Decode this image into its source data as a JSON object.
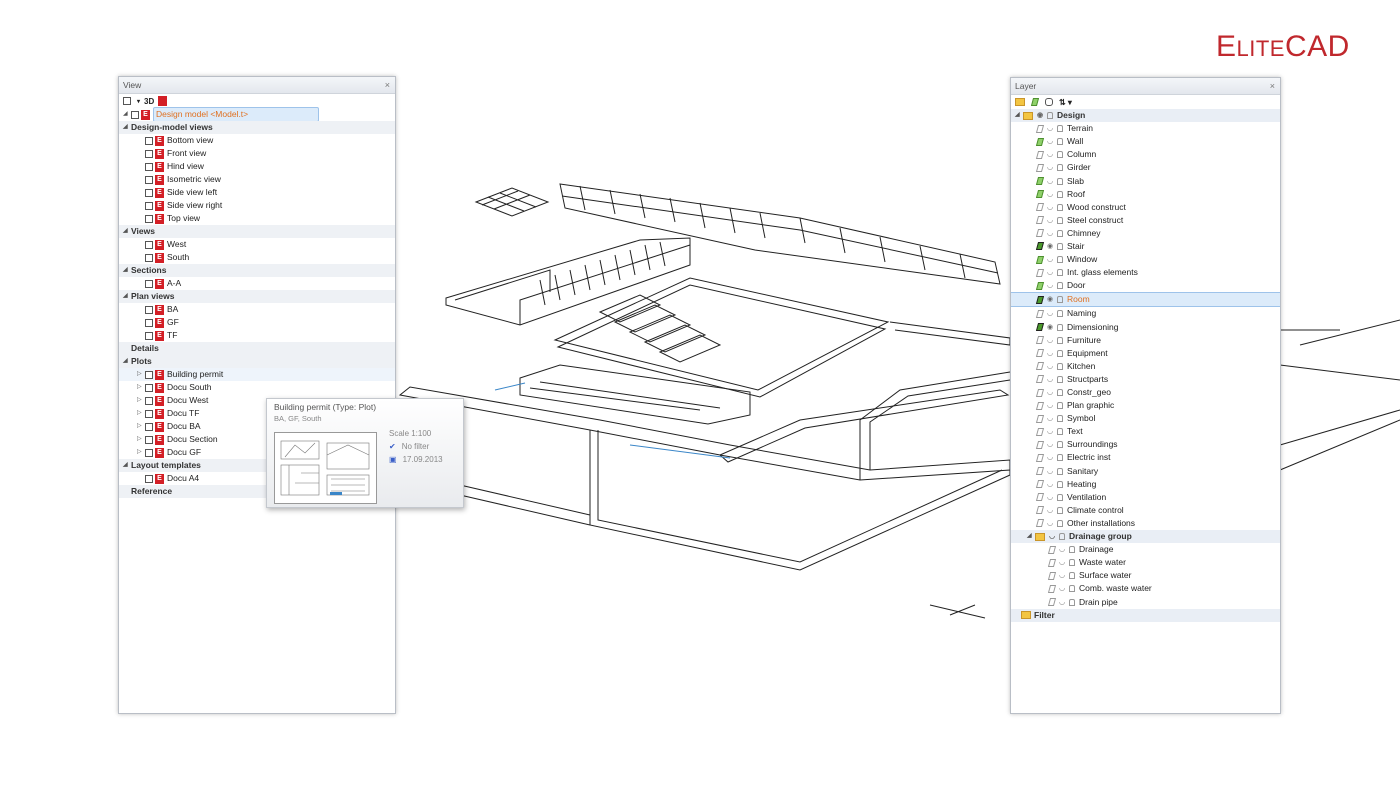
{
  "logo": {
    "e": "E",
    "lite": "LITE",
    "cad": "CAD"
  },
  "view_panel": {
    "title": "View",
    "close": "×",
    "toolbar_3d": "3D",
    "root_label": "Design model <Model.t>",
    "sections": [
      {
        "label": "Design-model views",
        "items": [
          "Bottom view",
          "Front view",
          "Hind view",
          "Isometric view",
          "Side view left",
          "Side view right",
          "Top view"
        ]
      },
      {
        "label": "Views",
        "items": [
          "West",
          "South"
        ]
      },
      {
        "label": "Sections",
        "items": [
          "A-A"
        ]
      },
      {
        "label": "Plan views",
        "items": [
          "BA",
          "GF",
          "TF"
        ]
      },
      {
        "label": "Details",
        "items": []
      },
      {
        "label": "Plots",
        "items": [
          "Building permit",
          "Docu South",
          "Docu West",
          "Docu TF",
          "Docu BA",
          "Docu Section",
          "Docu GF"
        ]
      },
      {
        "label": "Layout templates",
        "items": [
          "Docu A4"
        ]
      },
      {
        "label": "Reference",
        "items": []
      }
    ]
  },
  "tooltip": {
    "title": "Building permit  (Type: Plot)",
    "subtitle": "BA, GF, South",
    "scale": "Scale   1:100",
    "filter": "No filter",
    "date": "17.09.2013"
  },
  "layer_panel": {
    "title": "Layer",
    "close": "×",
    "root": "Design",
    "layers": [
      {
        "name": "Terrain",
        "state": "off"
      },
      {
        "name": "Wall",
        "state": "on"
      },
      {
        "name": "Column",
        "state": "off"
      },
      {
        "name": "Girder",
        "state": "off"
      },
      {
        "name": "Slab",
        "state": "on"
      },
      {
        "name": "Roof",
        "state": "on"
      },
      {
        "name": "Wood construct",
        "state": "off"
      },
      {
        "name": "Steel construct",
        "state": "off"
      },
      {
        "name": "Chimney",
        "state": "off"
      },
      {
        "name": "Stair",
        "state": "dark"
      },
      {
        "name": "Window",
        "state": "on"
      },
      {
        "name": "Int. glass elements",
        "state": "off"
      },
      {
        "name": "Door",
        "state": "on"
      },
      {
        "name": "Room",
        "state": "active"
      },
      {
        "name": "Naming",
        "state": "off"
      },
      {
        "name": "Dimensioning",
        "state": "dark"
      },
      {
        "name": "Furniture",
        "state": "off"
      },
      {
        "name": "Equipment",
        "state": "off"
      },
      {
        "name": "Kitchen",
        "state": "off"
      },
      {
        "name": "Structparts",
        "state": "off"
      },
      {
        "name": "Constr_geo",
        "state": "off"
      },
      {
        "name": "Plan graphic",
        "state": "off"
      },
      {
        "name": "Symbol",
        "state": "off"
      },
      {
        "name": "Text",
        "state": "off"
      },
      {
        "name": "Surroundings",
        "state": "off"
      },
      {
        "name": "Electric inst",
        "state": "off"
      },
      {
        "name": "Sanitary",
        "state": "off"
      },
      {
        "name": "Heating",
        "state": "off"
      },
      {
        "name": "Ventilation",
        "state": "off"
      },
      {
        "name": "Climate control",
        "state": "off"
      },
      {
        "name": "Other installations",
        "state": "off"
      }
    ],
    "group": "Drainage group",
    "group_layers": [
      "Drainage",
      "Waste water",
      "Surface water",
      "Comb. waste water",
      "Drain pipe"
    ],
    "filter": "Filter"
  }
}
